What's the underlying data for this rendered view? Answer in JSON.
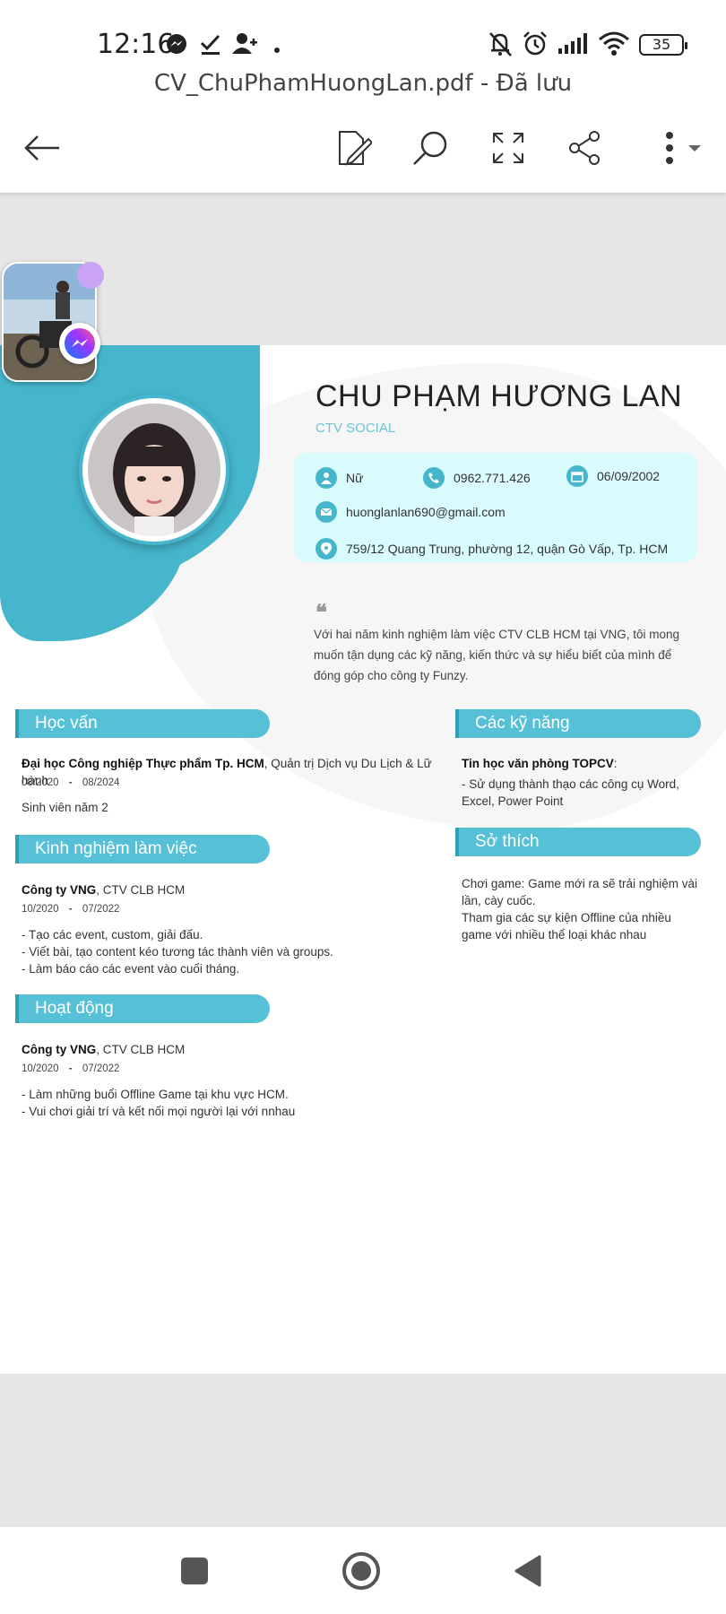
{
  "status_bar": {
    "time": "12:16",
    "battery": "35",
    "icons": [
      "messenger-icon",
      "check-icon",
      "add-person-icon",
      "dot-icon",
      "mute-icon",
      "alarm-icon",
      "signal-icon",
      "wifi-icon",
      "battery-icon"
    ]
  },
  "header": {
    "title": "CV_ChuPhamHuongLan.pdf - Đã lưu",
    "actions": [
      "back-icon",
      "edit-icon",
      "search-icon",
      "fullscreen-icon",
      "share-icon",
      "more-icon"
    ]
  },
  "cv": {
    "name": "CHU PHẠM HƯƠNG LAN",
    "role": "CTV SOCIAL",
    "gender": "Nữ",
    "phone": "0962.771.426",
    "birthday": "06/09/2002",
    "email": "huonglanlan690@gmail.com",
    "address": "759/12 Quang Trung, phường 12, quận Gò Vấp,  Tp. HCM",
    "quote_mark": "❝",
    "objective": "Với hai năm kinh nghiệm làm việc CTV CLB HCM tại VNG, tôi mong muốn tận dụng các kỹ năng, kiến thức và sự hiểu biết của mình để đóng góp cho công ty Funzy.",
    "education": {
      "heading": "Học vấn",
      "school": "Đại học Công nghiệp Thực phẩm Tp. HCM",
      "major": ", Quản trị Dịch vụ Du Lịch & Lữ hành",
      "from": "08/2020",
      "to": "08/2024",
      "sep": "-",
      "note": "Sinh viên năm 2"
    },
    "experience": {
      "heading": "Kinh nghiệm làm việc",
      "company": "Công ty VNG",
      "position": ", CTV CLB HCM",
      "from": "10/2020",
      "to": "07/2022",
      "sep": "-",
      "items": [
        "- Tạo các event, custom, giải đấu.",
        "- Viết bài, tạo content kéo tương tác thành viên và groups.",
        "- Làm báo cáo các event vào cuối tháng."
      ]
    },
    "activities": {
      "heading": "Hoạt động",
      "company": "Công ty VNG",
      "position": ", CTV CLB HCM",
      "from": "10/2020",
      "to": "07/2022",
      "sep": "-",
      "items": [
        "- Làm những buổi Offline Game tại khu vực HCM.",
        "- Vui chơi giải trí và kết nối mọi người lại với nnhau"
      ]
    },
    "skills": {
      "heading": "Các kỹ năng",
      "title": "Tin học văn phòng TOPCV",
      "colon": ":",
      "detail": "- Sử dụng thành thạo các công cụ Word, Excel, Power Point"
    },
    "hobbies": {
      "heading": "Sở thích",
      "line1": "Chơi game: Game mới ra sẽ trải nghiệm vài lần, cày cuốc.",
      "line2": "Tham gia các sự kiện Offline của nhiều game với nhiều thể loại khác nhau"
    }
  },
  "colors": {
    "accent": "#46b6cd",
    "section": "#56c1d6",
    "info_bg": "#d9fbfd",
    "role_text": "#6cc4d6"
  },
  "nav": [
    "recent-apps-icon",
    "home-icon",
    "back-triangle-icon"
  ]
}
